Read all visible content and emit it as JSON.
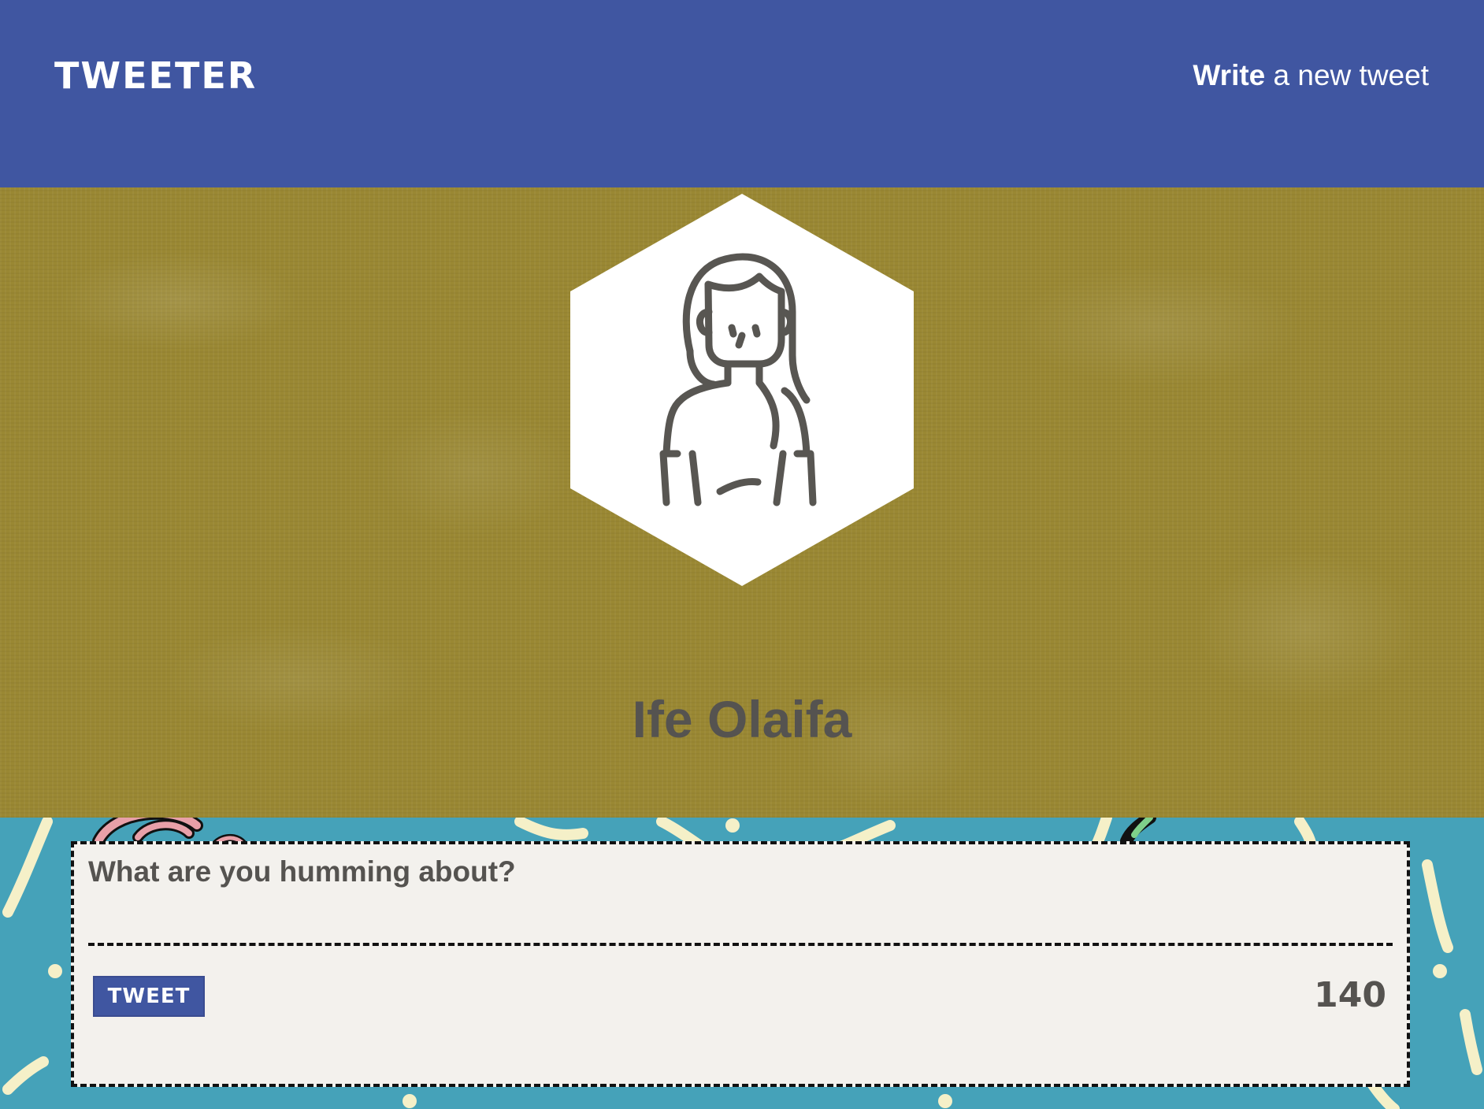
{
  "nav": {
    "brand": "TWEETER",
    "compose_strong": "Write",
    "compose_rest": " a new tweet"
  },
  "profile": {
    "name": "Ife Olaifa",
    "avatar_icon": "woman-avatar-icon"
  },
  "composer": {
    "placeholder": "What are you humming about?",
    "value": "",
    "button_label": "TWEET",
    "char_count": "140"
  },
  "colors": {
    "nav_bg": "#4056a1",
    "header_bg": "#9a8833",
    "bottom_bg": "#45a2b9",
    "composer_bg": "#f3f1ed",
    "text_dark": "#555350"
  }
}
